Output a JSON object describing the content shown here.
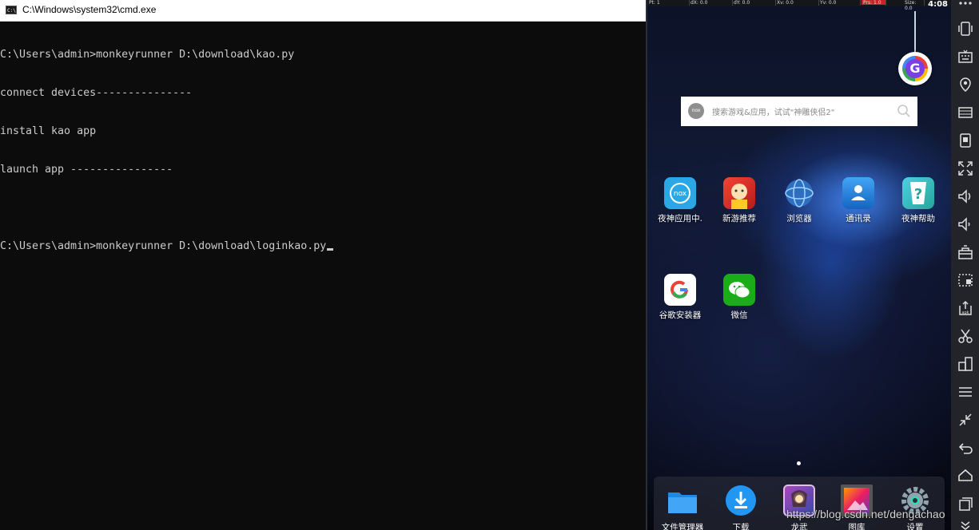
{
  "cmd": {
    "title": "C:\\Windows\\system32\\cmd.exe",
    "lines": [
      "C:\\Users\\admin>monkeyrunner D:\\download\\kao.py",
      "connect devices---------------",
      "install kao app",
      "launch app ----------------",
      "",
      "C:\\Users\\admin>monkeyrunner D:\\download\\loginkao.py"
    ]
  },
  "emulator": {
    "statusbar": {
      "time": "4:08",
      "cells": [
        "Pt: 1",
        "dX: 0.0",
        "dY: 0.0",
        "Xv: 0.0",
        "Yv: 0.0",
        "Prs: 1.0",
        "Size: 0.0"
      ]
    },
    "search": {
      "placeholder": "搜索游戏&应用，试试\"神雕侠侣2\"",
      "badge": "nox"
    },
    "apps_row1": [
      {
        "label": "夜神应用中.",
        "icon": "nox-app-center-icon",
        "color": "#2aa8e6"
      },
      {
        "label": "新游推荐",
        "icon": "new-games-icon",
        "color": "#e53935"
      },
      {
        "label": "浏览器",
        "icon": "browser-globe-icon",
        "color": "#3a7bd5"
      },
      {
        "label": "通讯录",
        "icon": "contacts-icon",
        "color": "#1e88e5"
      },
      {
        "label": "夜神帮助",
        "icon": "nox-help-icon",
        "color": "#26c6a6"
      }
    ],
    "apps_row2": [
      {
        "label": "谷歌安装器",
        "icon": "google-installer-icon",
        "color": "#ffffff"
      },
      {
        "label": "微信",
        "icon": "wechat-icon",
        "color": "#1aad19"
      }
    ],
    "dock": [
      {
        "label": "文件管理器",
        "icon": "folder-icon",
        "color": "#1e88e5"
      },
      {
        "label": "下载",
        "icon": "download-icon",
        "color": "#1e88e5"
      },
      {
        "label": "龙武",
        "icon": "game-longwu-icon",
        "color": "#7e57c2"
      },
      {
        "label": "图库",
        "icon": "gallery-icon",
        "color": "#e91e63"
      },
      {
        "label": "设置",
        "icon": "settings-gear-icon",
        "color": "#90a4ae"
      }
    ]
  },
  "toolbar": {
    "items": [
      "shake-icon",
      "keyboard-icon",
      "location-icon",
      "screen-mode-icon",
      "screenshot-icon",
      "fullscreen-icon",
      "volume-up-icon",
      "volume-down-icon",
      "toolbox-icon",
      "record-icon",
      "apk-install-icon",
      "scissors-icon",
      "multi-instance-icon",
      "menu-icon",
      "shrink-icon",
      "back-icon",
      "home-icon",
      "recent-apps-icon"
    ]
  },
  "watermark": "https://blog.csdn.net/dengachao"
}
